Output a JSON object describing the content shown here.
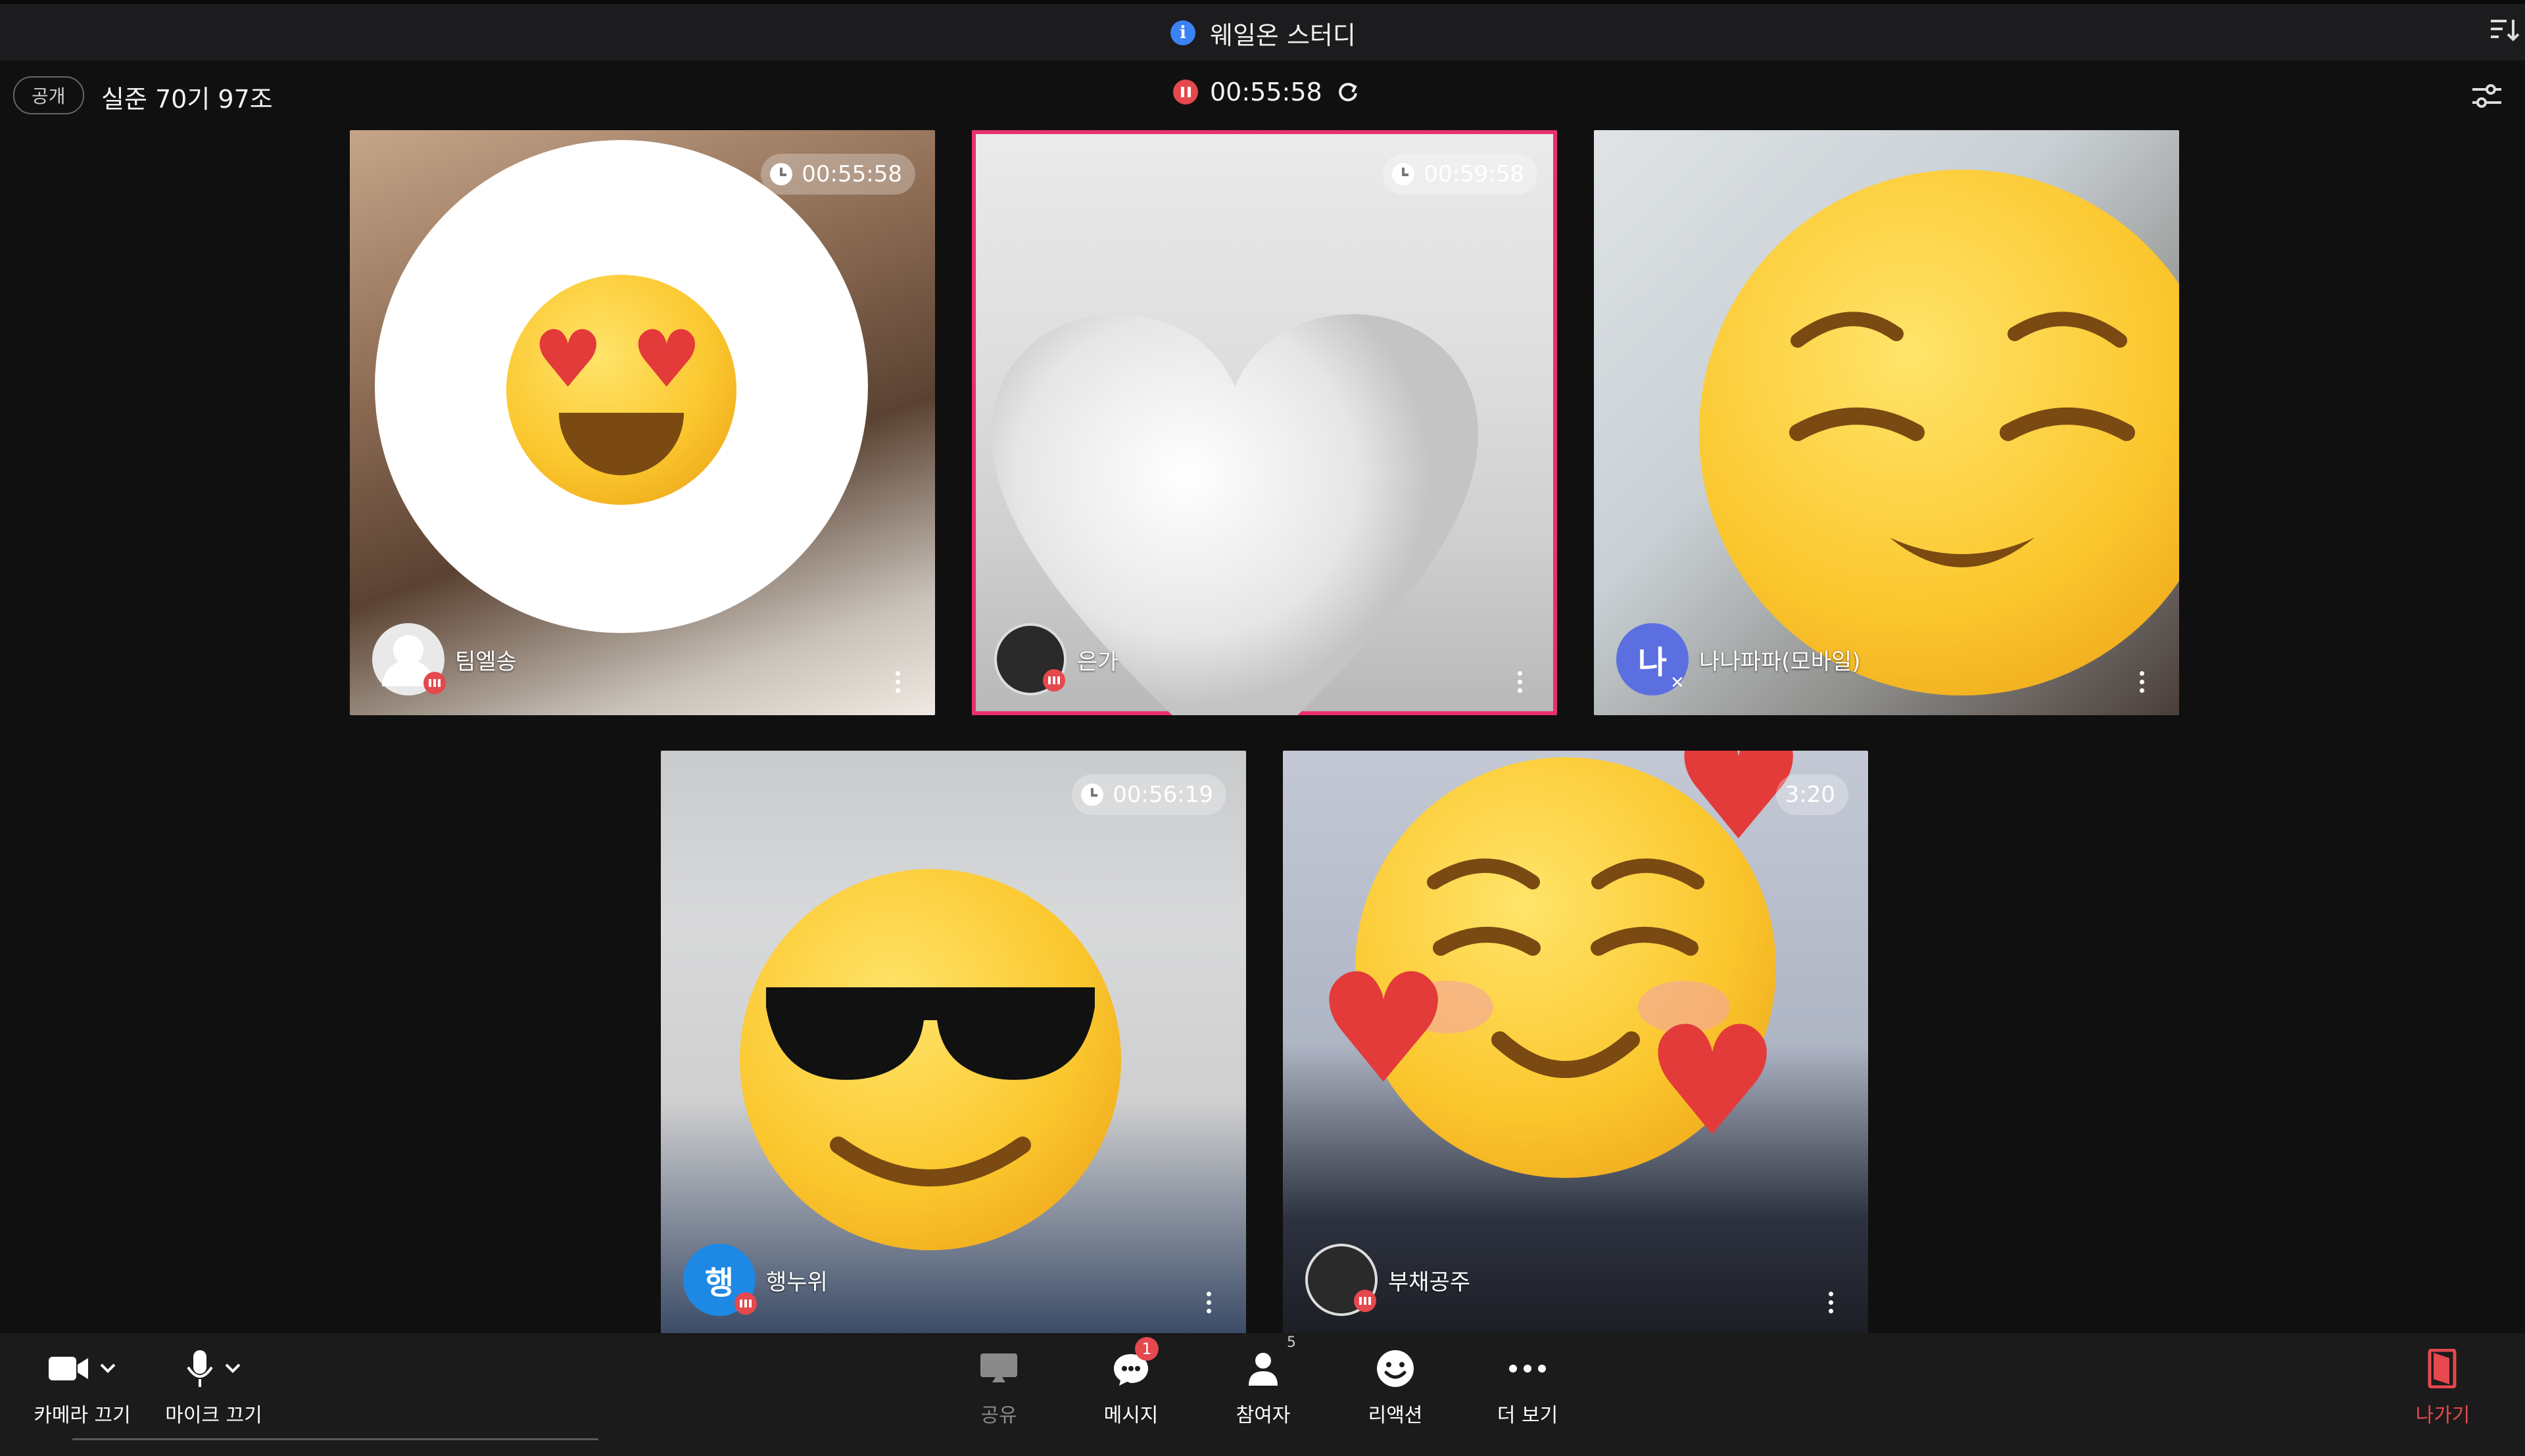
{
  "window": {
    "title": "웨일온 스터디"
  },
  "room": {
    "visibility_badge": "공개",
    "name": "실준 70기 97조"
  },
  "session": {
    "elapsed": "00:55:58"
  },
  "participants": [
    {
      "name": "팀엘송",
      "timer": "00:55:58",
      "avatar_letter": "",
      "mic": "on",
      "face_emoji": "heart-eyes-emoji"
    },
    {
      "name": "은가",
      "timer": "00:59:58",
      "avatar_letter": "",
      "mic": "on",
      "active_speaker": true,
      "face_emoji": "white-heart-emoji"
    },
    {
      "name": "나나파파(모바일)",
      "timer": "",
      "avatar_letter": "나",
      "mic": "off",
      "face_emoji": "relieved-face-emoji"
    },
    {
      "name": "행누위",
      "timer": "00:56:19",
      "avatar_letter": "행",
      "mic": "on",
      "face_emoji": "sunglasses-emoji"
    },
    {
      "name": "부채공주",
      "timer": "3:20",
      "avatar_letter": "",
      "mic": "on",
      "face_emoji": "smiling-hearts-emoji"
    }
  ],
  "toolbar": {
    "camera_label": "카메라 끄기",
    "mic_label": "마이크 끄기",
    "share_label": "공유",
    "message_label": "메시지",
    "message_badge": "1",
    "participants_label": "참여자",
    "participants_count": "5",
    "reaction_label": "리액션",
    "more_label": "더 보기",
    "leave_label": "나가기"
  },
  "colors": {
    "accent_red": "#e5484d",
    "active_border": "#e8306f",
    "avatar_blue": "#1e88e5",
    "avatar_purple": "#5b6fe0"
  }
}
